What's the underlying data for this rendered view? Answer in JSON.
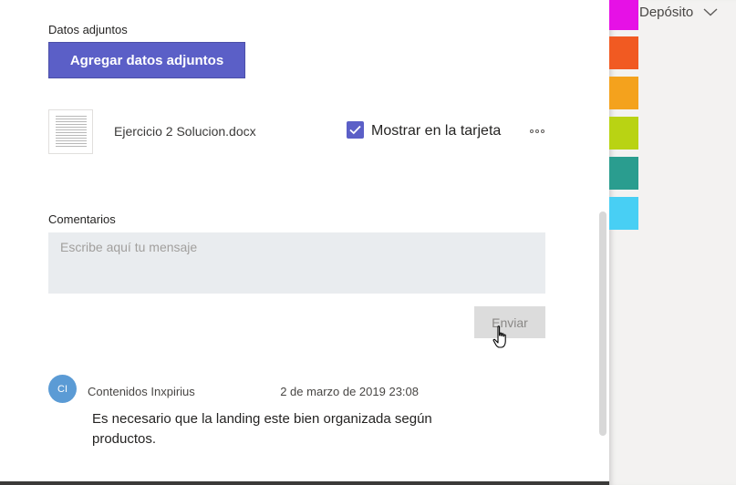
{
  "attachments": {
    "label": "Datos adjuntos",
    "add_button": "Agregar datos adjuntos",
    "file_name": "Ejercicio 2 Solucion.docx",
    "show_on_card_label": "Mostrar en la tarjeta",
    "show_on_card_checked": true
  },
  "comments": {
    "label": "Comentarios",
    "placeholder": "Escribe aquí tu mensaje",
    "send_button": "Enviar",
    "items": [
      {
        "avatar_initials": "CI",
        "author": "Contenidos Inxpirius",
        "timestamp": "2 de marzo de 2019 23:08",
        "text": "Es necesario que la landing este bien organizada según productos."
      }
    ]
  },
  "bucket": {
    "label": "Depósito"
  },
  "colors": {
    "accent": "#5b5fc7",
    "swatches": [
      "#e611e6",
      "#f15a22",
      "#f4a21d",
      "#b9d313",
      "#2a9d8f",
      "#48cff4"
    ]
  },
  "icons": {
    "more": "more-options-icon",
    "chevron": "chevron-down-icon",
    "check": "checkmark-icon",
    "cursor": "hand-pointer-icon"
  }
}
